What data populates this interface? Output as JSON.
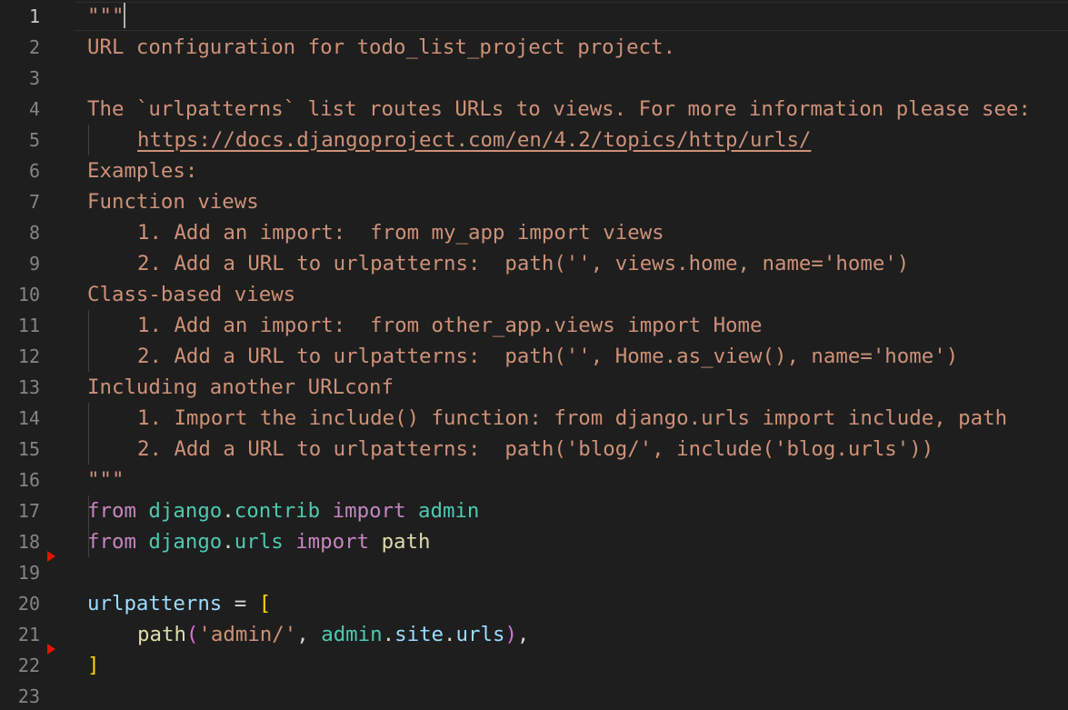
{
  "editor": {
    "language": "python",
    "current_line": "1",
    "line_numbers": [
      "1",
      "2",
      "3",
      "4",
      "5",
      "6",
      "7",
      "8",
      "9",
      "10",
      "11",
      "12",
      "13",
      "14",
      "15",
      "16",
      "17",
      "18",
      "19",
      "20",
      "21",
      "22",
      "23"
    ],
    "docstring": {
      "open": "\"\"\"",
      "l2": "URL configuration for todo_list_project project.",
      "l4": "The `urlpatterns` list routes URLs to views. For more information please see:",
      "l5": "https://docs.djangoproject.com/en/4.2/topics/http/urls/",
      "l6": "Examples:",
      "l7": "Function views",
      "l8": "1. Add an import:  from my_app import views",
      "l9": "2. Add a URL to urlpatterns:  path('', views.home, name='home')",
      "l10": "Class-based views",
      "l11": "1. Add an import:  from other_app.views import Home",
      "l12": "2. Add a URL to urlpatterns:  path('', Home.as_view(), name='home')",
      "l13": "Including another URLconf",
      "l14": "1. Import the include() function: from django.urls import include, path",
      "l15": "2. Add a URL to urlpatterns:  path('blog/', include('blog.urls'))",
      "close": "\"\"\""
    },
    "l17": {
      "kw_from": "from",
      "mod1": "django",
      "dot": ".",
      "mod2": "contrib",
      "kw_import": "import",
      "name": "admin"
    },
    "l18": {
      "kw_from": "from",
      "mod1": "django",
      "dot": ".",
      "mod2": "urls",
      "kw_import": "import",
      "name": "path"
    },
    "l20": {
      "var": "urlpatterns",
      "eq": "=",
      "bracket": "["
    },
    "l21": {
      "fn": "path",
      "paren_open": "(",
      "str": "'admin/'",
      "comma": ",",
      "obj": "admin",
      "dot1": ".",
      "attr1": "site",
      "dot2": ".",
      "attr2": "urls",
      "paren_close": ")",
      "trail": ","
    },
    "l22": {
      "bracket": "]"
    }
  },
  "colors": {
    "background": "#1e1e1e",
    "string": "#ce9178",
    "keyword": "#c586c0",
    "module": "#4ec9b0",
    "function": "#dcdcaa",
    "variable": "#9cdcfe",
    "bracket_level1": "#ffd700",
    "bracket_level2": "#da70d6",
    "line_number": "#858585",
    "fold_marker": "#e51400"
  }
}
